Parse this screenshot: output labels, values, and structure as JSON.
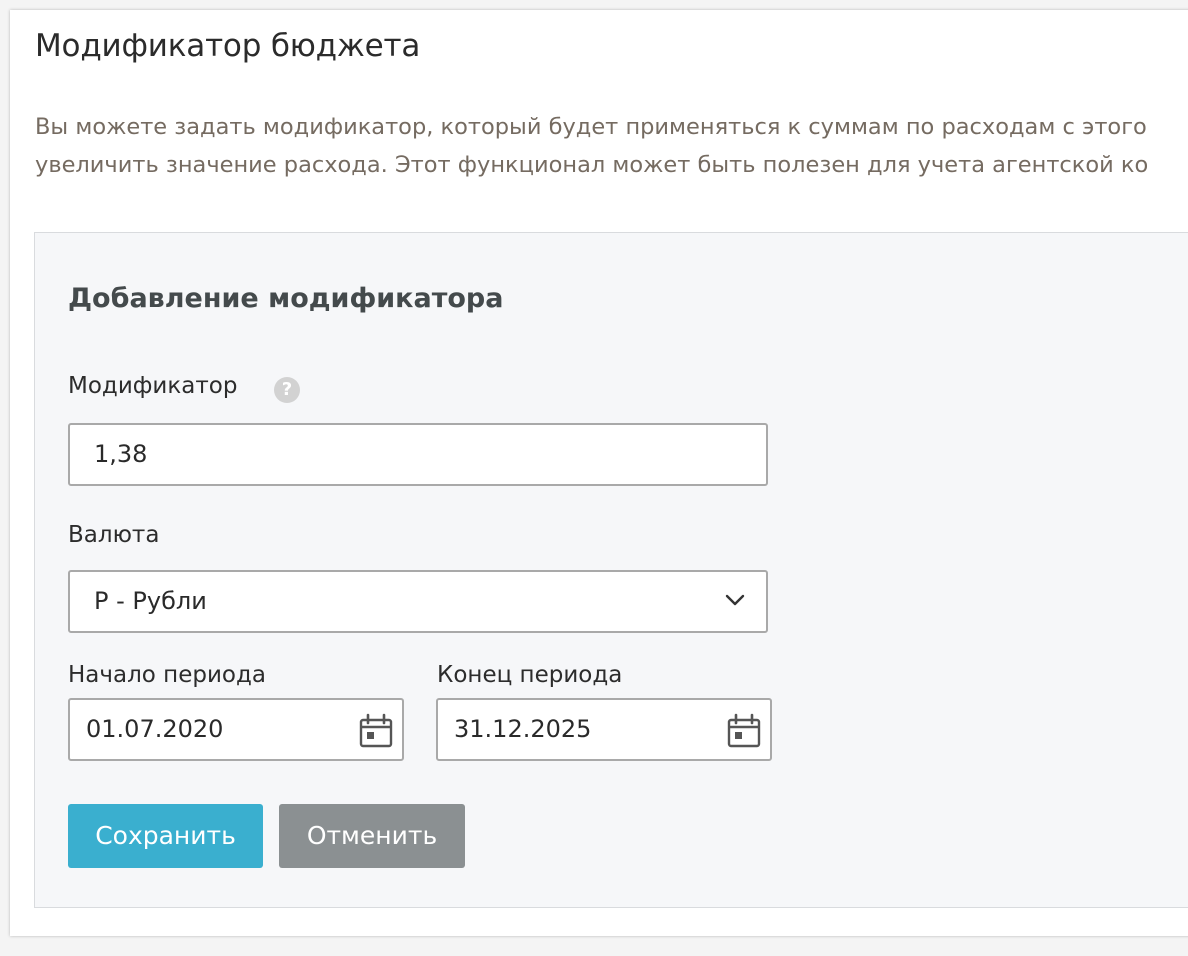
{
  "header": {
    "title": "Модификатор бюджета"
  },
  "description": {
    "line1": "Вы можете задать модификатор, который будет применяться к суммам по расходам с этого",
    "line2": "увеличить значение расхода. Этот функционал может быть полезен для учета агентской ко"
  },
  "form": {
    "title": "Добавление модификатора",
    "modifier": {
      "label": "Модификатор",
      "help_icon": "question-circle-icon",
      "value": "1,38"
    },
    "currency": {
      "label": "Валюта",
      "selected": "Р - Рубли",
      "icon": "chevron-down-icon"
    },
    "period_start": {
      "label": "Начало периода",
      "value": "01.07.2020",
      "icon": "calendar-icon"
    },
    "period_end": {
      "label": "Конец периода",
      "value": "31.12.2025",
      "icon": "calendar-icon"
    },
    "buttons": {
      "save_label": "Сохранить",
      "cancel_label": "Отменить"
    }
  },
  "colors": {
    "save_button": "#3aafcf",
    "cancel_button": "#8b9092",
    "description_text": "#756b61",
    "panel_background": "#f6f7f9"
  }
}
